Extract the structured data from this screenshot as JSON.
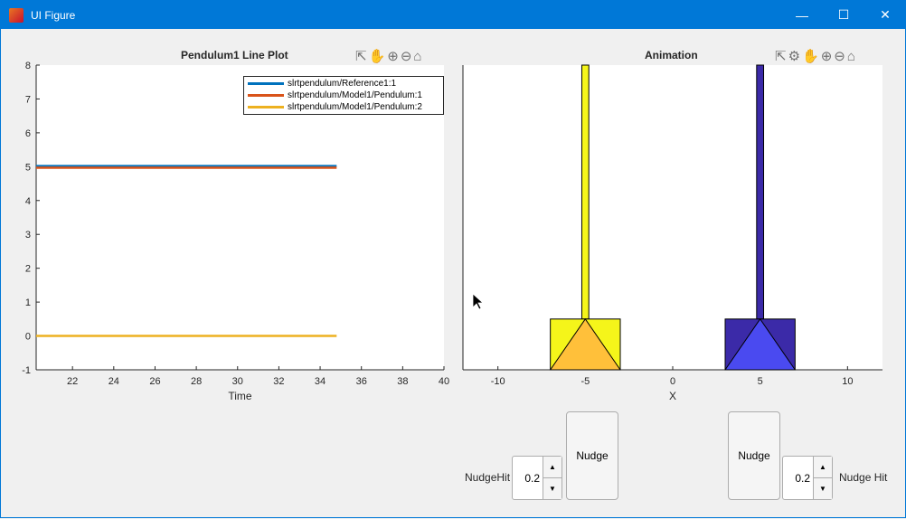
{
  "window": {
    "title": "UI Figure"
  },
  "line_plot": {
    "title": "Pendulum1 Line Plot",
    "xlabel": "Time",
    "xlim": [
      20.24,
      40
    ],
    "ylim": [
      -1,
      8
    ],
    "xticks": [
      22,
      24,
      26,
      28,
      30,
      32,
      34,
      36,
      38,
      40
    ],
    "yticks": [
      -1,
      0,
      1,
      2,
      3,
      4,
      5,
      6,
      7,
      8
    ],
    "series": [
      {
        "name": "slrtpendulum/Reference1:1",
        "color": "#0072bd",
        "x": [
          20.24,
          34.8
        ],
        "y": [
          5.02,
          5.02
        ]
      },
      {
        "name": "slrtpendulum/Model1/Pendulum:1",
        "color": "#d95319",
        "x": [
          20.24,
          34.8
        ],
        "y": [
          4.97,
          4.97
        ]
      },
      {
        "name": "slrtpendulum/Model1/Pendulum:2",
        "color": "#edb120",
        "x": [
          20.24,
          34.8
        ],
        "y": [
          0,
          0
        ]
      }
    ]
  },
  "animation": {
    "title": "Animation",
    "xlabel": "X",
    "xlim": [
      -12,
      12
    ],
    "ylim": [
      0,
      6
    ],
    "xticks": [
      -10,
      -5,
      0,
      5,
      10
    ],
    "carts": [
      {
        "center": -5,
        "color": "#f5f51a",
        "wheel": "#ffc03a",
        "rod": "#f5f51a"
      },
      {
        "center": 5,
        "color": "#3b2aa8",
        "wheel": "#4a4af0",
        "rod": "#3b2aa8"
      }
    ]
  },
  "controls": {
    "left": {
      "label": "NudgeHit",
      "value": "0.2",
      "button": "Nudge"
    },
    "right": {
      "label": "Nudge Hit",
      "value": "0.2",
      "button": "Nudge"
    }
  }
}
